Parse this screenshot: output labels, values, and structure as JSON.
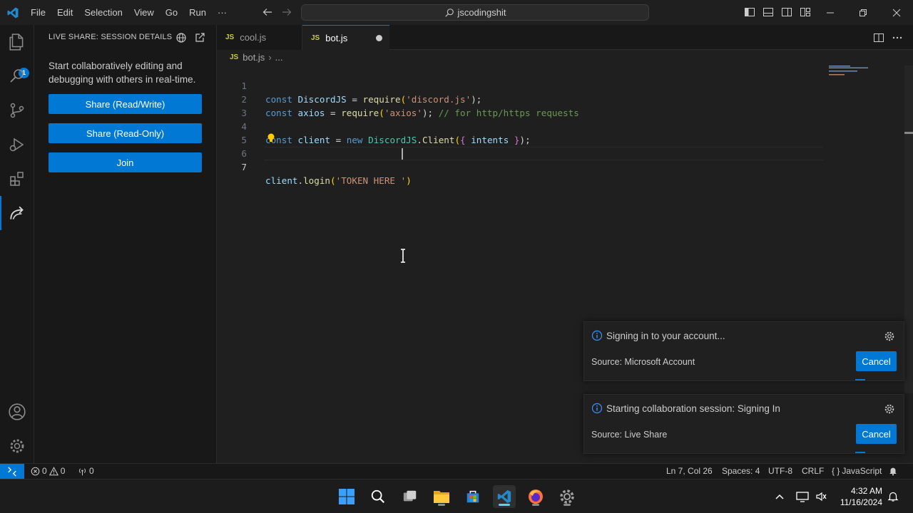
{
  "titlebar": {
    "menu": [
      "File",
      "Edit",
      "Selection",
      "View",
      "Go",
      "Run",
      "···"
    ],
    "search_text": "jscodingshit"
  },
  "activity": {
    "explorer_badge": "1"
  },
  "sidebar": {
    "title": "LIVE SHARE: SESSION DETAILS",
    "description": "Start collaboratively editing and debugging with others in real-time.",
    "buttons": [
      "Share (Read/Write)",
      "Share (Read-Only)",
      "Join"
    ]
  },
  "tabs": [
    {
      "badge": "JS",
      "label": "cool.js"
    },
    {
      "badge": "JS",
      "label": "bot.js"
    }
  ],
  "breadcrumb": {
    "badge": "JS",
    "file": "bot.js",
    "rest": "..."
  },
  "code": {
    "line_numbers": [
      "1",
      "2",
      "3",
      "4",
      "5",
      "6",
      "7"
    ],
    "l1": {
      "kw": "const",
      "var": "DiscordJS",
      "eq": " = ",
      "fn": "require",
      "p1": "(",
      "str": "'discord.js'",
      "p2": ");"
    },
    "l2": {
      "kw": "const",
      "var": "axios",
      "eq": " = ",
      "fn": "require",
      "p1": "(",
      "str": "'axios'",
      "p2": "); ",
      "cmt": "// for http/https requests"
    },
    "l4": {
      "kw": "const",
      "var": "client",
      "eq": " = ",
      "kw2": "new",
      "cls": "DiscordJS",
      "dot": ".",
      "fn": "Client",
      "p1": "(",
      "b1": "{",
      "var2": " intents ",
      "b2": "}",
      "p2": ");"
    },
    "l7": {
      "var": "client",
      "dot": ".",
      "fn": "login",
      "p1": "(",
      "str": "'TOKEN HERE '",
      "p2": ")"
    }
  },
  "notifications": [
    {
      "message": "Signing in to your account...",
      "source": "Source: Microsoft Account",
      "button": "Cancel"
    },
    {
      "message": "Starting collaboration session: Signing In",
      "source": "Source: Live Share",
      "button": "Cancel"
    }
  ],
  "status": {
    "errors": "0",
    "warnings": "0",
    "ports": "0",
    "position": "Ln 7, Col 26",
    "spaces": "Spaces: 4",
    "encoding": "UTF-8",
    "eol": "CRLF",
    "language": "JavaScript"
  },
  "clock": {
    "time": "4:32 AM",
    "date": "11/16/2024"
  },
  "colors": {
    "accent": "#0078d4",
    "background": "#1f1f1f",
    "sidebar": "#181818"
  }
}
